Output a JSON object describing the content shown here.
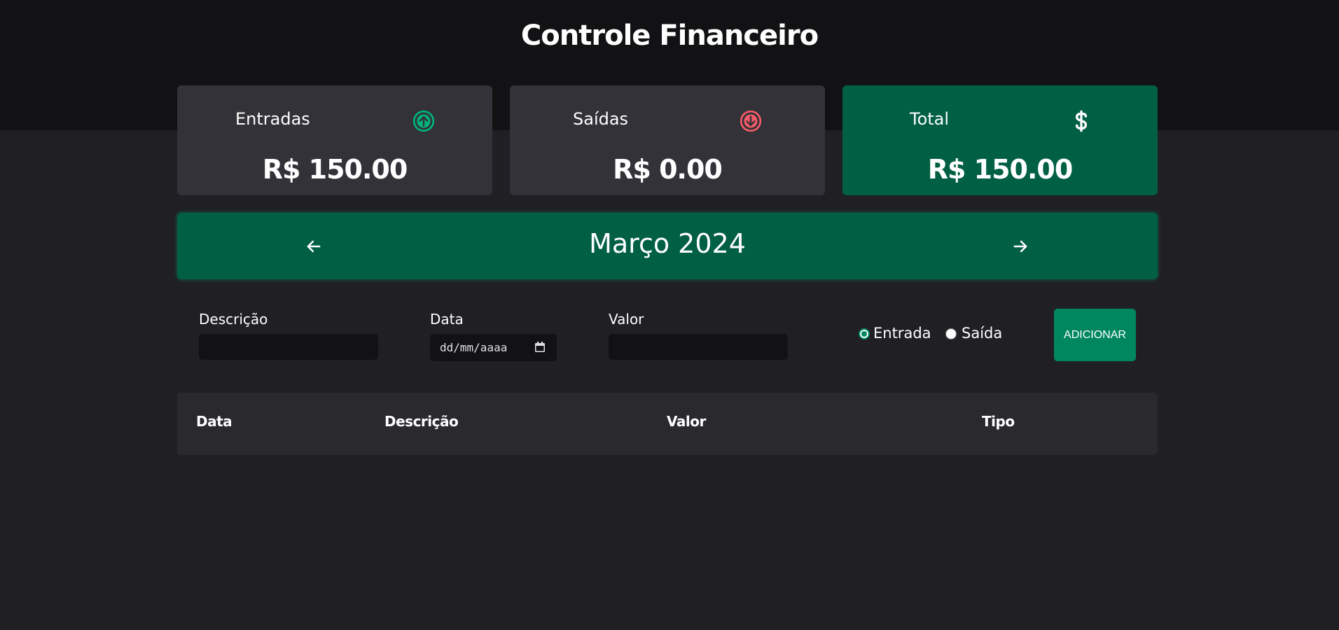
{
  "header": {
    "title": "Controle Financeiro"
  },
  "summary": {
    "income": {
      "label": "Entradas",
      "value": "R$ 150.00",
      "icon": "arrow-circle-up-icon",
      "icon_color": "#00b37e"
    },
    "expense": {
      "label": "Saídas",
      "value": "R$ 0.00",
      "icon": "arrow-circle-down-icon",
      "icon_color": "#f75a68"
    },
    "total": {
      "label": "Total",
      "value": "R$ 150.00",
      "icon": "dollar-sign-icon",
      "background": "#015f43"
    }
  },
  "month_nav": {
    "label": "Março 2024",
    "prev_icon": "arrow-left-icon",
    "next_icon": "arrow-right-icon"
  },
  "form": {
    "description_label": "Descrição",
    "description_value": "",
    "date_label": "Data",
    "date_placeholder": "dd/mm/aaaa",
    "amount_label": "Valor",
    "amount_value": "",
    "type_options": [
      {
        "label": "Entrada",
        "checked": true
      },
      {
        "label": "Saída",
        "checked": false
      }
    ],
    "add_button": "ADICIONAR"
  },
  "table": {
    "columns": [
      "Data",
      "Descrição",
      "Valor",
      "Tipo"
    ],
    "rows": []
  },
  "colors": {
    "accent": "#00875f",
    "accent_dark": "#015f43",
    "background": "#202024",
    "header_bg": "#121214"
  }
}
